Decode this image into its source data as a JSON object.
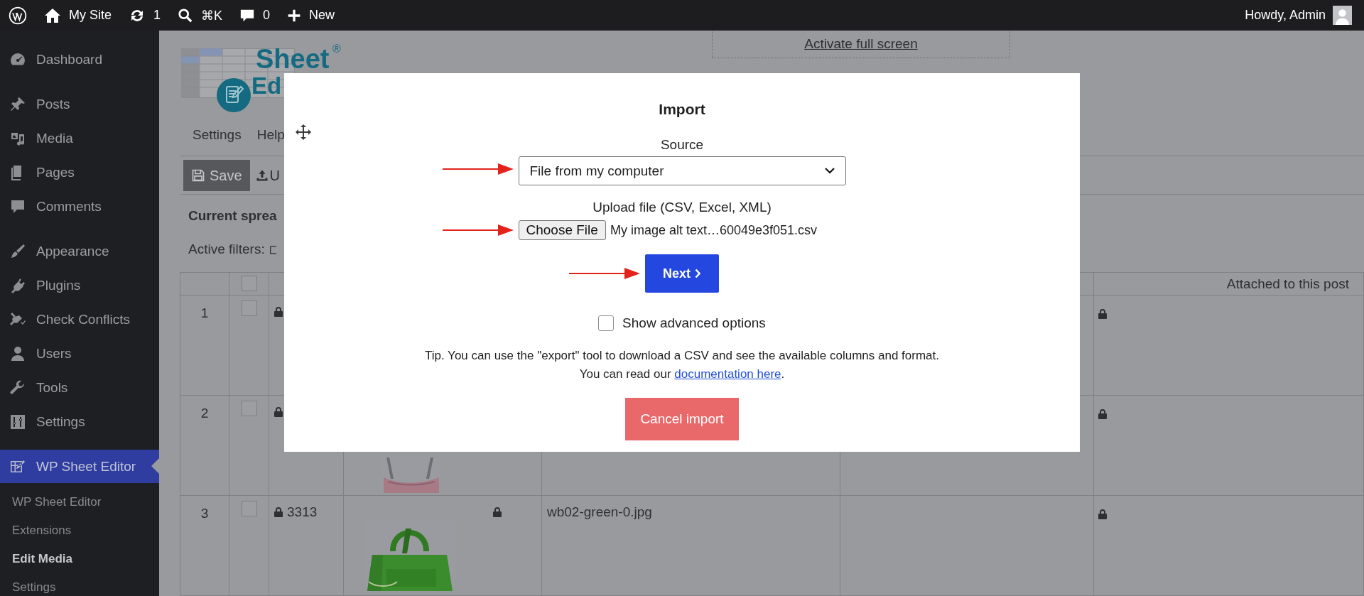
{
  "admin_bar": {
    "site_name": "My Site",
    "updates": "1",
    "shortcut": "⌘K",
    "comments": "0",
    "new_label": "New",
    "greeting": "Howdy, Admin"
  },
  "sidebar": {
    "groups": [
      {
        "items": [
          {
            "label": "Dashboard",
            "selected": false
          }
        ]
      },
      {
        "items": [
          {
            "label": "Posts",
            "selected": false
          },
          {
            "label": "Media",
            "selected": false
          },
          {
            "label": "Pages",
            "selected": false
          },
          {
            "label": "Comments",
            "selected": false
          }
        ]
      },
      {
        "items": [
          {
            "label": "Appearance",
            "selected": false
          },
          {
            "label": "Plugins",
            "selected": false
          },
          {
            "label": "Check Conflicts",
            "selected": false
          },
          {
            "label": "Users",
            "selected": false
          },
          {
            "label": "Tools",
            "selected": false
          },
          {
            "label": "Settings",
            "selected": false
          }
        ]
      },
      {
        "items": [
          {
            "label": "WP Sheet Editor",
            "selected": true,
            "children": [
              {
                "label": "WP Sheet Editor",
                "selected": false
              },
              {
                "label": "Extensions",
                "selected": false
              },
              {
                "label": "Edit Media",
                "selected": true
              },
              {
                "label": "Settings",
                "selected": false
              }
            ]
          }
        ]
      }
    ]
  },
  "page": {
    "logo": {
      "word": "Sheet",
      "mark": "®",
      "word_2": "Ed"
    },
    "fullscreen_link": "Activate full screen",
    "menu": [
      {
        "label": "Settings"
      },
      {
        "label": "Help"
      }
    ],
    "toolbar": [
      {
        "label": "Save",
        "kind": "primary"
      },
      {
        "label": "U",
        "kind": "plain"
      }
    ],
    "heading": "Current sprea",
    "filters_label": "Active filters:",
    "table": {
      "header_checkbox": {
        "checked": false
      },
      "last_column_header": "Attached to this post",
      "rows": [
        {
          "number": "1",
          "checked": false
        },
        {
          "number": "2",
          "checked": false
        },
        {
          "number": "3",
          "checked": false,
          "id": "3313",
          "file": "wb02-green-0.jpg"
        }
      ]
    }
  },
  "modal": {
    "title": "Import",
    "source_label": "Source",
    "source_value": "File from my computer",
    "upload_label": "Upload file (CSV, Excel, XML)",
    "choose_button": "Choose File",
    "file_name": "My image alt text…60049e3f051.csv",
    "next_button": "Next",
    "advanced": {
      "label": "Show advanced options",
      "checked": false
    },
    "tip": "Tip. You can use the \"export\" tool to download a CSV and see the available columns and format.",
    "read_prefix": "You can read our ",
    "read_link": "documentation here",
    "read_suffix": ".",
    "cancel_button": "Cancel import"
  }
}
